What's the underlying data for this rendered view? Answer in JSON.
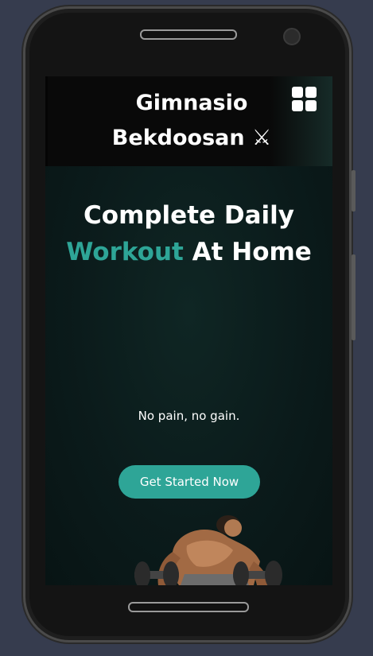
{
  "navbar": {
    "brand": "Gimnasio Bekdoosan ⚔",
    "menu_icon": "grid-icon"
  },
  "hero": {
    "title_part1": "Complete Daily",
    "title_accent": "Workout",
    "title_part2": "At Home",
    "tagline": "No pain, no gain.",
    "cta_label": "Get Started Now",
    "image": "bodybuilder-with-dumbbells-illustration"
  },
  "colors": {
    "accent": "#2ea597",
    "background": "#0a1818",
    "navbar": "#090909",
    "text": "#ffffff"
  }
}
